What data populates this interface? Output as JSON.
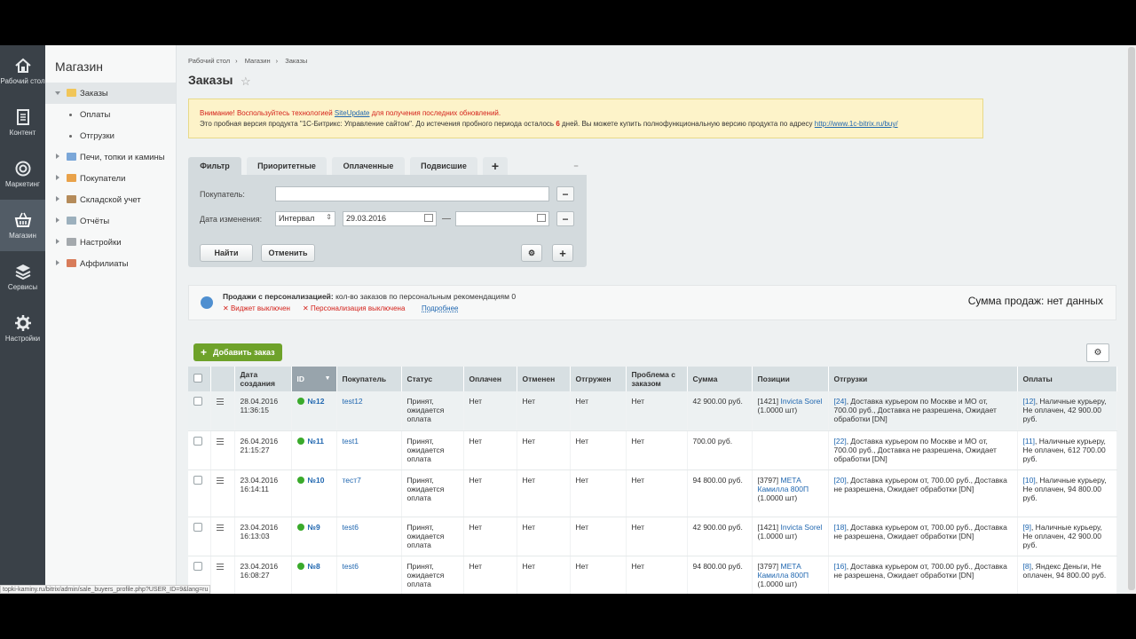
{
  "sidebar": [
    {
      "icon": "home-icon",
      "label": "Рабочий стол"
    },
    {
      "icon": "content-icon",
      "label": "Контент"
    },
    {
      "icon": "target-icon",
      "label": "Маркетинг"
    },
    {
      "icon": "basket-icon",
      "label": "Магазин"
    },
    {
      "icon": "layers-icon",
      "label": "Сервисы"
    },
    {
      "icon": "gear-icon",
      "label": "Настройки"
    }
  ],
  "menu": {
    "title": "Магазин",
    "items": [
      {
        "label": "Заказы"
      },
      {
        "label": "Оплаты"
      },
      {
        "label": "Отгрузки"
      },
      {
        "label": "Печи, топки и камины"
      },
      {
        "label": "Покупатели"
      },
      {
        "label": "Складской учет"
      },
      {
        "label": "Отчёты"
      },
      {
        "label": "Настройки"
      },
      {
        "label": "Аффилиаты"
      }
    ]
  },
  "breadcrumb": [
    "Рабочий стол",
    "Магазин",
    "Заказы"
  ],
  "page_title": "Заказы",
  "notice": {
    "l1_prefix": "Внимание! Воспользуйтесь технологией ",
    "l1_link": "SiteUpdate",
    "l1_suffix": " для получения последних обновлений.",
    "l2_prefix": "Это пробная версия продукта \"1С-Битрикс: Управление сайтом\". До истечения пробного периода осталось ",
    "l2_days": "6",
    "l2_suffix": " дней. Вы можете купить полнофункциональную версию продукта по адресу ",
    "l2_link": "http://www.1c-bitrix.ru/buy/"
  },
  "filter": {
    "tabs": [
      "Фильтр",
      "Приоритетные",
      "Оплаченные",
      "Подвисшие"
    ],
    "buyer_label": "Покупатель:",
    "buyer_value": "",
    "date_label": "Дата изменения:",
    "interval": "Интервал",
    "date_from": "29.03.2016",
    "date_to": "",
    "find": "Найти",
    "cancel": "Отменить"
  },
  "personalization": {
    "title": "Продажи с персонализацией:",
    "desc": " кол-во заказов по персональным рекомендациям 0",
    "widget": "Виджет выключен",
    "pers": "Персонализация выключена",
    "more": "Подробнее",
    "sum": "Сумма продаж: нет данных"
  },
  "grid": {
    "add": "Добавить заказ",
    "headers": [
      "Дата создания",
      "ID",
      "Покупатель",
      "Статус",
      "Оплачен",
      "Отменен",
      "Отгружен",
      "Проблема с заказом",
      "Сумма",
      "Позиции",
      "Отгрузки",
      "Оплаты"
    ],
    "rows": [
      {
        "date": "28.04.2016",
        "time": "11:36:15",
        "id": "№12",
        "buyer": "test12",
        "status": "Принят, ожидается оплата",
        "paid": "Нет",
        "cancel": "Нет",
        "ship": "Нет",
        "prob": "Нет",
        "sum": "42 900.00 руб.",
        "pos_code": "[1421] ",
        "pos_name": "Invicta Sorel",
        "pos_qty": "(1.0000 шт)",
        "sh_code": "[24]",
        "sh_text": ", Доставка курьером по Москве и МО от, 700.00 руб., Доставка не разрешена, Ожидает обработки [DN]",
        "pay_code": "[12]",
        "pay_text": ", Наличные курьеру, Не оплачен, 42 900.00 руб."
      },
      {
        "date": "26.04.2016",
        "time": "21:15:27",
        "id": "№11",
        "buyer": "test1",
        "status": "Принят, ожидается оплата",
        "paid": "Нет",
        "cancel": "Нет",
        "ship": "Нет",
        "prob": "Нет",
        "sum": "700.00 руб.",
        "pos_code": "",
        "pos_name": "",
        "pos_qty": "",
        "sh_code": "[22]",
        "sh_text": ", Доставка курьером по Москве и МО от, 700.00 руб., Доставка не разрешена, Ожидает обработки [DN]",
        "pay_code": "[11]",
        "pay_text": ", Наличные курьеру, Не оплачен, 612 700.00 руб."
      },
      {
        "date": "23.04.2016",
        "time": "16:14:11",
        "id": "№10",
        "buyer": "тест7",
        "status": "Принят, ожидается оплата",
        "paid": "Нет",
        "cancel": "Нет",
        "ship": "Нет",
        "prob": "Нет",
        "sum": "94 800.00 руб.",
        "pos_code": "[3797] ",
        "pos_name": "МЕТА Камилла 800П",
        "pos_qty": "(1.0000 шт)",
        "sh_code": "[20]",
        "sh_text": ", Доставка курьером от, 700.00 руб., Доставка не разрешена, Ожидает обработки [DN]",
        "pay_code": "[10]",
        "pay_text": ", Наличные курьеру, Не оплачен, 94 800.00 руб."
      },
      {
        "date": "23.04.2016",
        "time": "16:13:03",
        "id": "№9",
        "buyer": "test6",
        "status": "Принят, ожидается оплата",
        "paid": "Нет",
        "cancel": "Нет",
        "ship": "Нет",
        "prob": "Нет",
        "sum": "42 900.00 руб.",
        "pos_code": "[1421] ",
        "pos_name": "Invicta Sorel",
        "pos_qty": "(1.0000 шт)",
        "sh_code": "[18]",
        "sh_text": ", Доставка курьером от, 700.00 руб., Доставка не разрешена, Ожидает обработки [DN]",
        "pay_code": "[9]",
        "pay_text": ", Наличные курьеру, Не оплачен, 42 900.00 руб."
      },
      {
        "date": "23.04.2016",
        "time": "16:08:27",
        "id": "№8",
        "buyer": "test6",
        "status": "Принят, ожидается оплата",
        "paid": "Нет",
        "cancel": "Нет",
        "ship": "Нет",
        "prob": "Нет",
        "sum": "94 800.00 руб.",
        "pos_code": "[3797] ",
        "pos_name": "МЕТА Камилла 800П",
        "pos_qty": "(1.0000 шт)",
        "sh_code": "[16]",
        "sh_text": ", Доставка курьером от, 700.00 руб., Доставка не разрешена, Ожидает обработки [DN]",
        "pay_code": "[8]",
        "pay_text": ", Яндекс Деньги, Не оплачен, 94 800.00 руб."
      }
    ]
  },
  "status_url": "topki-kaminy.ru/bitrix/admin/sale_buyers_profile.php?USER_ID=9&lang=ru"
}
